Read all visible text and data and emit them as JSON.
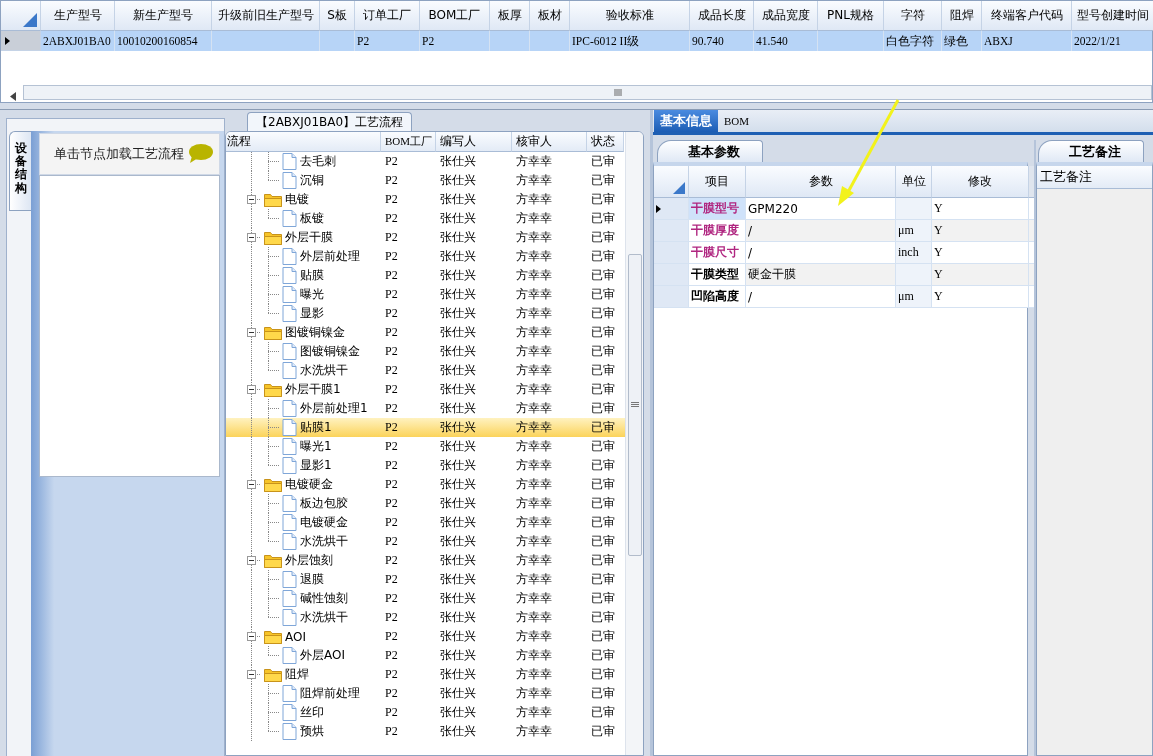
{
  "top_grid": {
    "columns": [
      "生产型号",
      "新生产型号",
      "升级前旧生产型号",
      "S板",
      "订单工厂",
      "BOM工厂",
      "板厚",
      "板材",
      "验收标准",
      "成品长度",
      "成品宽度",
      "PNL规格",
      "字符",
      "阻焊",
      "终端客户代码",
      "型号创建时间"
    ],
    "rows": [
      {
        "selected": true,
        "cells": [
          "2ABXJ01BA0",
          "10010200160854",
          null,
          null,
          "P2",
          "P2",
          null,
          null,
          "IPC-6012 II级",
          "90.740",
          "41.540",
          null,
          "白色字符",
          "绿色",
          "ABXJ",
          "2022/1/21"
        ]
      }
    ]
  },
  "side_tab": {
    "label": "设备结构"
  },
  "hint": {
    "text": "单击节点加载工艺流程"
  },
  "process_tab": {
    "title": "【2ABXJ01BA0】工艺流程"
  },
  "tree": {
    "columns": [
      "流程",
      "BOM工厂",
      "编写人",
      "核审人",
      "状态"
    ],
    "nodes": [
      {
        "expanded": true,
        "children": [
          {
            "label": "去毛刺",
            "bom": "P2",
            "writer": "张仕兴",
            "reviewer": "方幸幸",
            "status": "已审",
            "selected": false
          },
          {
            "label": "沉铜",
            "bom": "P2",
            "writer": "张仕兴",
            "reviewer": "方幸幸",
            "status": "已审",
            "selected": false
          }
        ]
      },
      {
        "label": "电镀",
        "bom": "P2",
        "writer": "张仕兴",
        "reviewer": "方幸幸",
        "status": "已审",
        "selected": false,
        "expanded": true,
        "children": [
          {
            "label": "板镀",
            "bom": "P2",
            "writer": "张仕兴",
            "reviewer": "方幸幸",
            "status": "已审",
            "selected": false
          }
        ]
      },
      {
        "label": "外层干膜",
        "bom": "P2",
        "writer": "张仕兴",
        "reviewer": "方幸幸",
        "status": "已审",
        "selected": false,
        "expanded": true,
        "children": [
          {
            "label": "外层前处理",
            "bom": "P2",
            "writer": "张仕兴",
            "reviewer": "方幸幸",
            "status": "已审",
            "selected": false
          },
          {
            "label": "贴膜",
            "bom": "P2",
            "writer": "张仕兴",
            "reviewer": "方幸幸",
            "status": "已审",
            "selected": false
          },
          {
            "label": "曝光",
            "bom": "P2",
            "writer": "张仕兴",
            "reviewer": "方幸幸",
            "status": "已审",
            "selected": false
          },
          {
            "label": "显影",
            "bom": "P2",
            "writer": "张仕兴",
            "reviewer": "方幸幸",
            "status": "已审",
            "selected": false
          }
        ]
      },
      {
        "label": "图镀铜镍金",
        "bom": "P2",
        "writer": "张仕兴",
        "reviewer": "方幸幸",
        "status": "已审",
        "selected": false,
        "expanded": true,
        "children": [
          {
            "label": "图镀铜镍金",
            "bom": "P2",
            "writer": "张仕兴",
            "reviewer": "方幸幸",
            "status": "已审",
            "selected": false
          },
          {
            "label": "水洗烘干",
            "bom": "P2",
            "writer": "张仕兴",
            "reviewer": "方幸幸",
            "status": "已审",
            "selected": false
          }
        ]
      },
      {
        "label": "外层干膜1",
        "bom": "P2",
        "writer": "张仕兴",
        "reviewer": "方幸幸",
        "status": "已审",
        "selected": false,
        "expanded": true,
        "children": [
          {
            "label": "外层前处理1",
            "bom": "P2",
            "writer": "张仕兴",
            "reviewer": "方幸幸",
            "status": "已审",
            "selected": false
          },
          {
            "label": "贴膜1",
            "bom": "P2",
            "writer": "张仕兴",
            "reviewer": "方幸幸",
            "status": "已审",
            "selected": true
          },
          {
            "label": "曝光1",
            "bom": "P2",
            "writer": "张仕兴",
            "reviewer": "方幸幸",
            "status": "已审",
            "selected": false
          },
          {
            "label": "显影1",
            "bom": "P2",
            "writer": "张仕兴",
            "reviewer": "方幸幸",
            "status": "已审",
            "selected": false
          }
        ]
      },
      {
        "label": "电镀硬金",
        "bom": "P2",
        "writer": "张仕兴",
        "reviewer": "方幸幸",
        "status": "已审",
        "selected": false,
        "expanded": true,
        "children": [
          {
            "label": "板边包胶",
            "bom": "P2",
            "writer": "张仕兴",
            "reviewer": "方幸幸",
            "status": "已审",
            "selected": false
          },
          {
            "label": "电镀硬金",
            "bom": "P2",
            "writer": "张仕兴",
            "reviewer": "方幸幸",
            "status": "已审",
            "selected": false
          },
          {
            "label": "水洗烘干",
            "bom": "P2",
            "writer": "张仕兴",
            "reviewer": "方幸幸",
            "status": "已审",
            "selected": false
          }
        ]
      },
      {
        "label": "外层蚀刻",
        "bom": "P2",
        "writer": "张仕兴",
        "reviewer": "方幸幸",
        "status": "已审",
        "selected": false,
        "expanded": true,
        "children": [
          {
            "label": "退膜",
            "bom": "P2",
            "writer": "张仕兴",
            "reviewer": "方幸幸",
            "status": "已审",
            "selected": false
          },
          {
            "label": "碱性蚀刻",
            "bom": "P2",
            "writer": "张仕兴",
            "reviewer": "方幸幸",
            "status": "已审",
            "selected": false
          },
          {
            "label": "水洗烘干",
            "bom": "P2",
            "writer": "张仕兴",
            "reviewer": "方幸幸",
            "status": "已审",
            "selected": false
          }
        ]
      },
      {
        "label": "AOI",
        "bom": "P2",
        "writer": "张仕兴",
        "reviewer": "方幸幸",
        "status": "已审",
        "selected": false,
        "expanded": true,
        "children": [
          {
            "label": "外层AOI",
            "bom": "P2",
            "writer": "张仕兴",
            "reviewer": "方幸幸",
            "status": "已审",
            "selected": false
          }
        ]
      },
      {
        "label": "阻焊",
        "bom": "P2",
        "writer": "张仕兴",
        "reviewer": "方幸幸",
        "status": "已审",
        "selected": false,
        "expanded": true,
        "children": [
          {
            "label": "阻焊前处理",
            "bom": "P2",
            "writer": "张仕兴",
            "reviewer": "方幸幸",
            "status": "已审",
            "selected": false
          },
          {
            "label": "丝印",
            "bom": "P2",
            "writer": "张仕兴",
            "reviewer": "方幸幸",
            "status": "已审",
            "selected": false
          },
          {
            "label": "预烘",
            "bom": "P2",
            "writer": "张仕兴",
            "reviewer": "方幸幸",
            "status": "已审",
            "selected": false
          }
        ]
      }
    ]
  },
  "info_tabs": [
    {
      "label": "基本信息",
      "selected": true
    },
    {
      "label": "BOM",
      "selected": false
    }
  ],
  "param_tab": {
    "label": "基本参数"
  },
  "params": {
    "columns": [
      "项目",
      "参数",
      "单位",
      "修改"
    ],
    "rows": [
      {
        "item": "干膜型号",
        "color": "#b02680",
        "value": "GPM220",
        "modify": "Y",
        "selected": true
      },
      {
        "item": "干膜厚度",
        "color": "#b02680",
        "value": "/",
        "unit": "μm",
        "modify": "Y",
        "selected": false
      },
      {
        "item": "干膜尺寸",
        "color": "#b02680",
        "value": "/",
        "unit": "inch",
        "modify": "Y",
        "selected": false
      },
      {
        "item": "干膜类型",
        "color": "#000000",
        "value": "硬金干膜",
        "modify": "Y",
        "selected": false
      },
      {
        "item": "凹陷高度",
        "color": "#000000",
        "value": "/",
        "unit": "μm",
        "modify": "Y",
        "selected": false
      }
    ]
  },
  "notes": {
    "tab": "工艺备注",
    "header": "工艺备注"
  }
}
